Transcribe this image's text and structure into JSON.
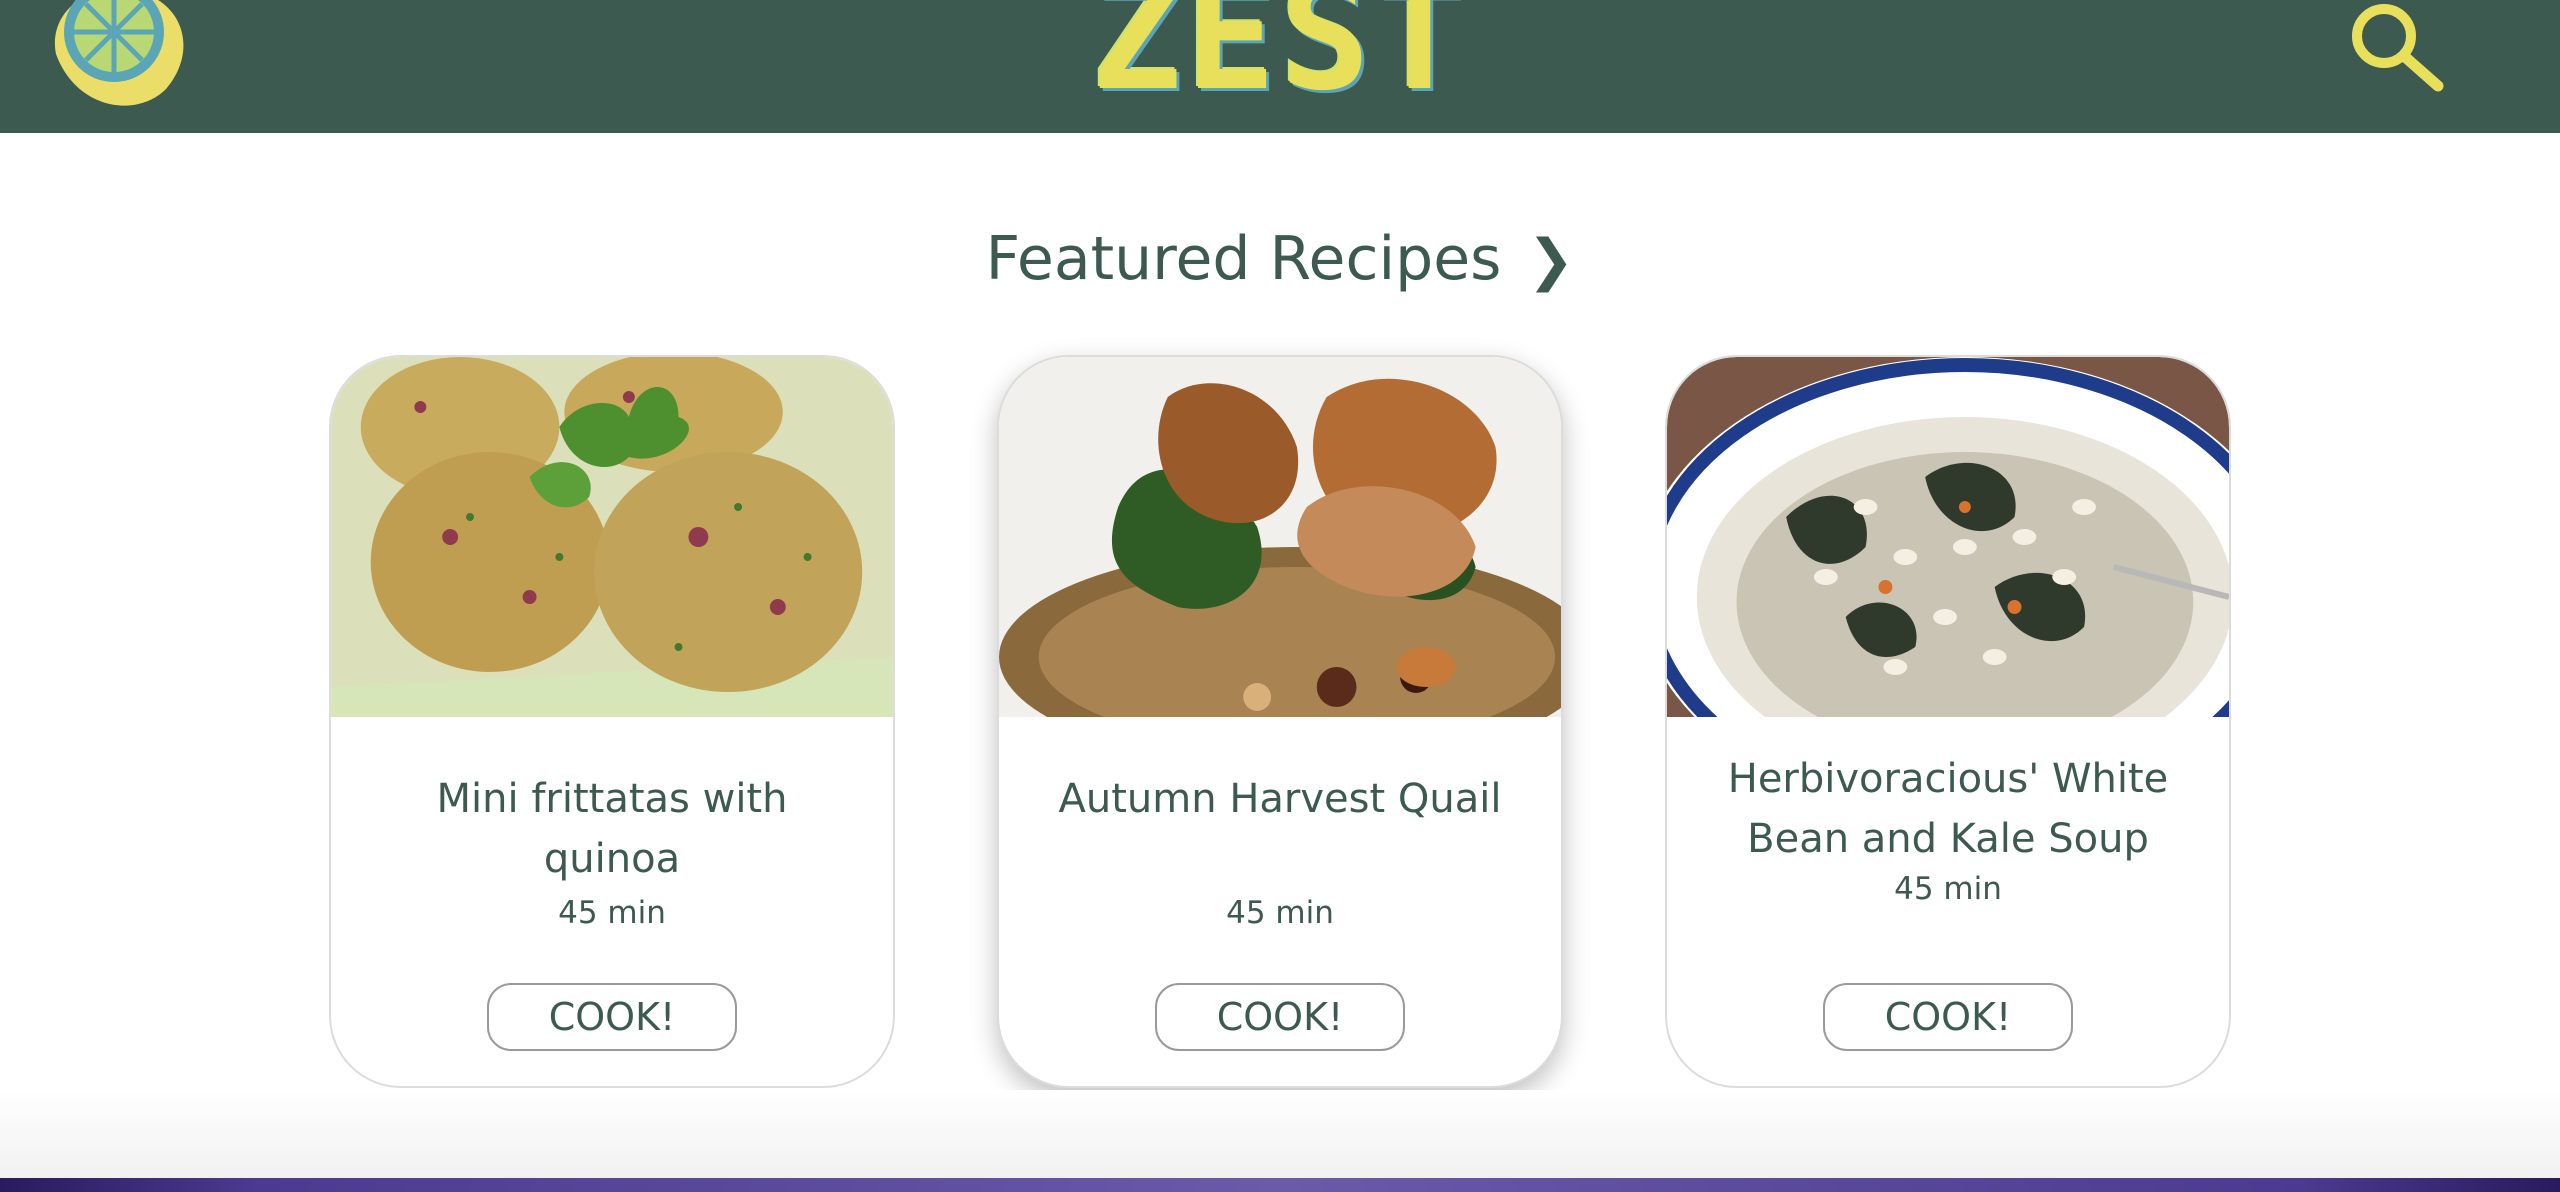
{
  "header": {
    "brand": "ZEST",
    "logo_icon": "lemon-slice-icon",
    "search_icon": "search-icon",
    "colors": {
      "background": "#3c5a4f",
      "brand": "#e8e05a",
      "accent": "#5aa6b6"
    }
  },
  "featured": {
    "title": "Featured Recipes",
    "chevron": "❯"
  },
  "cards": [
    {
      "title": "Mini frittatas with quinoa",
      "time": "45 min",
      "button": "COOK!",
      "image": "mini-frittatas-photo"
    },
    {
      "title": "Autumn Harvest Quail",
      "time": "45 min",
      "button": "COOK!",
      "image": "quail-photo"
    },
    {
      "title": "Herbivoracious' White Bean and Kale Soup",
      "time": "45 min",
      "button": "COOK!",
      "image": "bean-kale-soup-photo"
    }
  ]
}
